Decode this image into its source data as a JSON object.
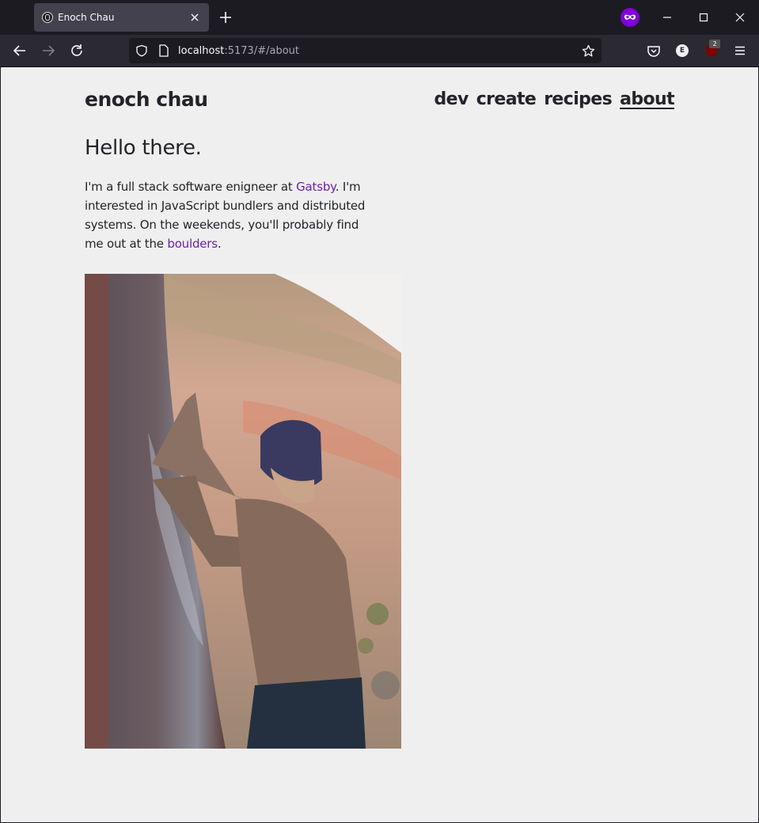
{
  "browser": {
    "tab_title": "Enoch Chau",
    "url_host": "localhost",
    "url_rest": ":5173/#/about",
    "extension_badge": "2",
    "extension_e_label": "E"
  },
  "site": {
    "title": "enoch chau",
    "nav": [
      "dev",
      "create",
      "recipes",
      "about"
    ],
    "active_nav": "about"
  },
  "about": {
    "greeting": "Hello there.",
    "bio_part1": "I'm a full stack software enigneer at ",
    "bio_link1": "Gatsby",
    "bio_part2": ". I'm interested in JavaScript bundlers and distributed systems. On the weekends, you'll probably find me out at the ",
    "bio_link2": "boulders",
    "bio_part3": "."
  },
  "colors": {
    "page_bg": "#f0efef",
    "text": "#24232a",
    "link": "#6b21a8",
    "private_badge": "#8000d7"
  },
  "icons": [
    "close-icon",
    "plus-icon",
    "private-mask-icon",
    "minimize-icon",
    "maximize-icon",
    "window-close-icon",
    "back-arrow-icon",
    "forward-arrow-icon",
    "reload-icon",
    "shield-icon",
    "page-icon",
    "star-icon",
    "pocket-icon",
    "menu-icon"
  ]
}
